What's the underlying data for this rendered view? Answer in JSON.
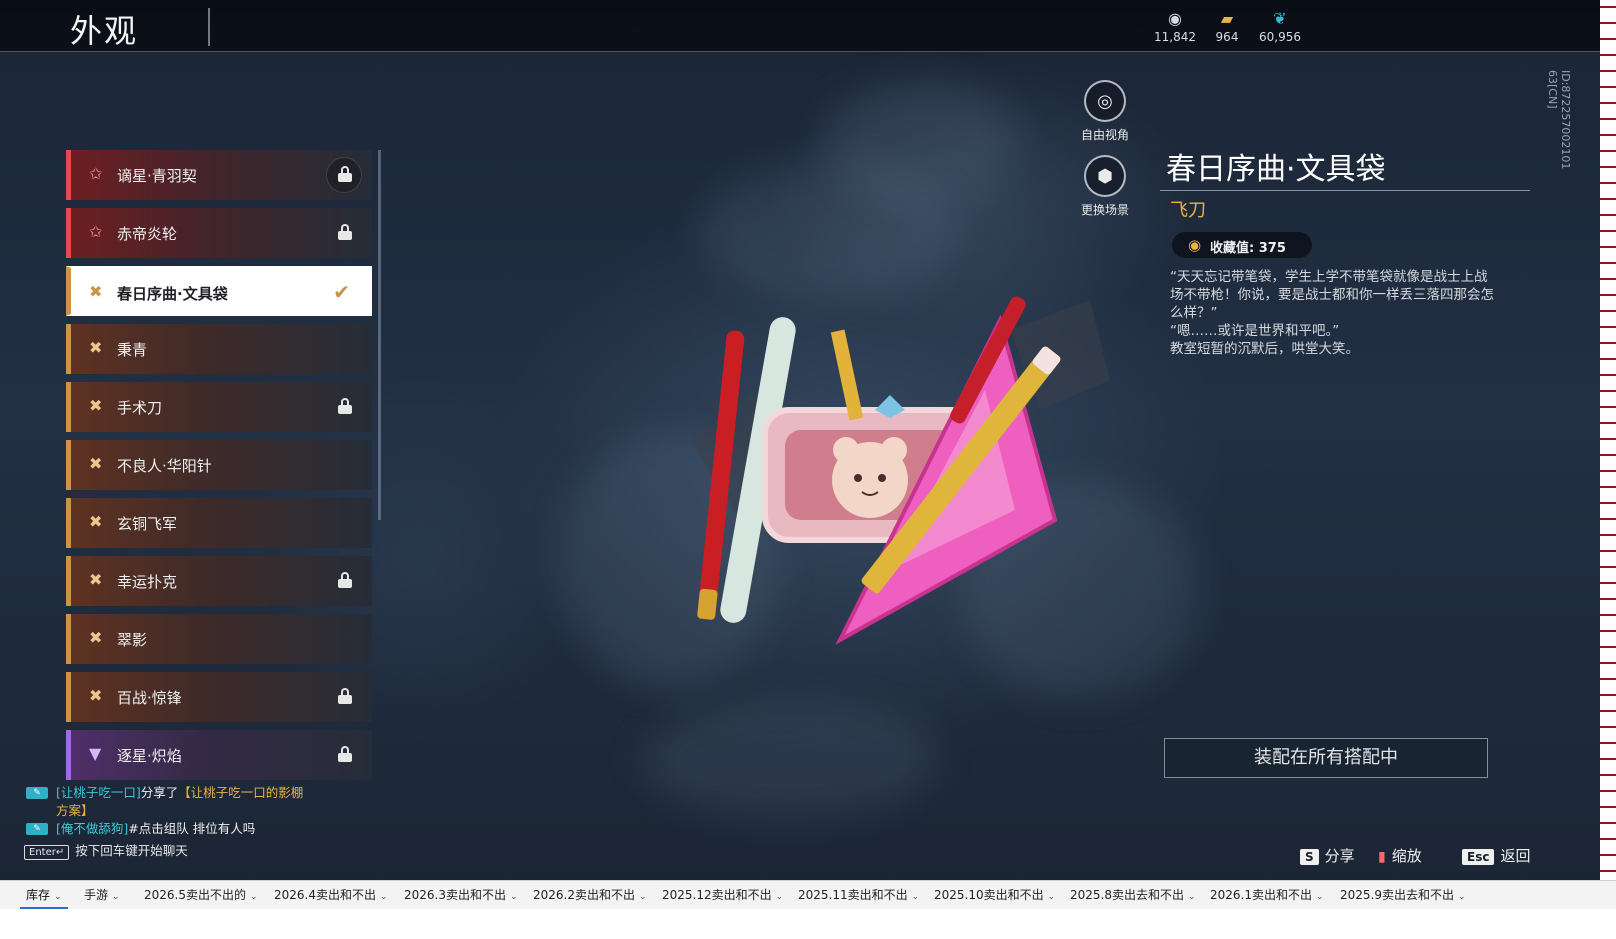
{
  "header": {
    "title": "外观",
    "currencies": [
      {
        "icon": "gem-cluster-icon",
        "value": "11,842",
        "color": "#d7dbe2"
      },
      {
        "icon": "gold-ticket-icon",
        "value": "964",
        "color": "#e7b34a"
      },
      {
        "icon": "feather-icon",
        "value": "60,956",
        "color": "#39b7d6"
      }
    ]
  },
  "skin_list": [
    {
      "label": "谪星·青羽契",
      "tier": "red",
      "icon": "star-icon",
      "locked": true,
      "selected": false
    },
    {
      "label": "赤帝炎轮",
      "tier": "red",
      "icon": "star-icon",
      "locked": true,
      "selected": false
    },
    {
      "label": "春日序曲·文具袋",
      "tier": "gold",
      "icon": "cross-icon",
      "locked": false,
      "selected": true
    },
    {
      "label": "秉青",
      "tier": "gold",
      "icon": "cross-icon",
      "locked": false,
      "selected": false
    },
    {
      "label": "手术刀",
      "tier": "gold",
      "icon": "cross-icon",
      "locked": true,
      "selected": false
    },
    {
      "label": "不良人·华阳针",
      "tier": "gold",
      "icon": "cross-icon",
      "locked": false,
      "selected": false
    },
    {
      "label": "玄铜飞军",
      "tier": "gold",
      "icon": "cross-icon",
      "locked": false,
      "selected": false
    },
    {
      "label": "幸运扑克",
      "tier": "gold",
      "icon": "cross-icon",
      "locked": true,
      "selected": false
    },
    {
      "label": "翠影",
      "tier": "gold",
      "icon": "cross-icon",
      "locked": false,
      "selected": false
    },
    {
      "label": "百战·惊锋",
      "tier": "gold",
      "icon": "cross-icon",
      "locked": true,
      "selected": false
    },
    {
      "label": "逐星·炽焰",
      "tier": "purple",
      "icon": "chevron-emblem-icon",
      "locked": true,
      "selected": false
    }
  ],
  "camera": {
    "free_view": "自由视角",
    "change_scene": "更换场景"
  },
  "detail": {
    "title": "春日序曲·文具袋",
    "type": "飞刀",
    "collect_label": "收藏值: 375",
    "description": [
      "“天天忘记带笔袋，学生上学不带笔袋就像是战士上战场不带枪！你说，要是战士都和你一样丢三落四那会怎么样？”",
      "“嗯……或许是世界和平吧。”",
      "教室短暂的沉默后，哄堂大笑。"
    ],
    "equip_button": "装配在所有搭配中",
    "vertical_id": "ID:872257002101 63[CN]"
  },
  "chat": {
    "messages": [
      {
        "name": "[让桃子吃一口]",
        "text": "分享了",
        "share": "【让桃子吃一口的影棚方案】"
      },
      {
        "name": "[俺不做舔狗]",
        "text": "#点击组队 排位有人吗",
        "share": ""
      }
    ],
    "enter_key": "Enter↵",
    "hint": "按下回车键开始聊天"
  },
  "key_hints": {
    "share_key": "S",
    "share": "分享",
    "zoom": "缩放",
    "back_key": "Esc",
    "back": "返回"
  },
  "sheet_tabs": [
    {
      "label": "库存",
      "active": true
    },
    {
      "label": "手游",
      "active": false
    },
    {
      "label": "2026.5卖出不出的",
      "active": false
    },
    {
      "label": "2026.4卖出和不出",
      "active": false
    },
    {
      "label": "2026.3卖出和不出",
      "active": false
    },
    {
      "label": "2026.2卖出和不出",
      "active": false
    },
    {
      "label": "2025.12卖出和不出",
      "active": false
    },
    {
      "label": "2025.11卖出和不出",
      "active": false
    },
    {
      "label": "2025.10卖出和不出",
      "active": false
    },
    {
      "label": "2025.8卖出去和不出",
      "active": false
    },
    {
      "label": "2026.1卖出和不出",
      "active": false
    },
    {
      "label": "2025.9卖出去和不出",
      "active": false
    }
  ],
  "colors": {
    "accent_gold": "#c9944a",
    "tier_red": "#e5484d",
    "tier_purple": "#a06be0",
    "type_text": "#e7b34a"
  }
}
